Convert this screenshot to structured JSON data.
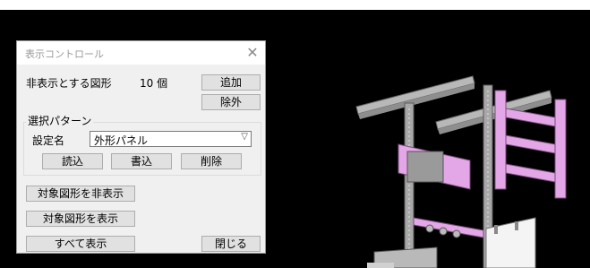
{
  "dialog": {
    "title": "表示コントロール",
    "hidden_shapes_label": "非表示とする図形",
    "hidden_count": "10 個",
    "add_label": "追加",
    "remove_label": "除外",
    "pattern_group_label": "選択パターン",
    "setting_name_label": "設定名",
    "setting_name_value": "外形パネル",
    "load_label": "読込",
    "write_label": "書込",
    "delete_label": "削除",
    "hide_target_label": "対象図形を非表示",
    "show_target_label": "対象図形を表示",
    "show_all_label": "すべて表示",
    "close_label": "閉じる"
  },
  "icons": {
    "close": "close-icon",
    "dropdown": "chevron-down-icon"
  },
  "colors": {
    "viewport_bg": "#000000",
    "pink_parts": "#e3a6e6",
    "grey_steel": "#a8a8a8"
  }
}
